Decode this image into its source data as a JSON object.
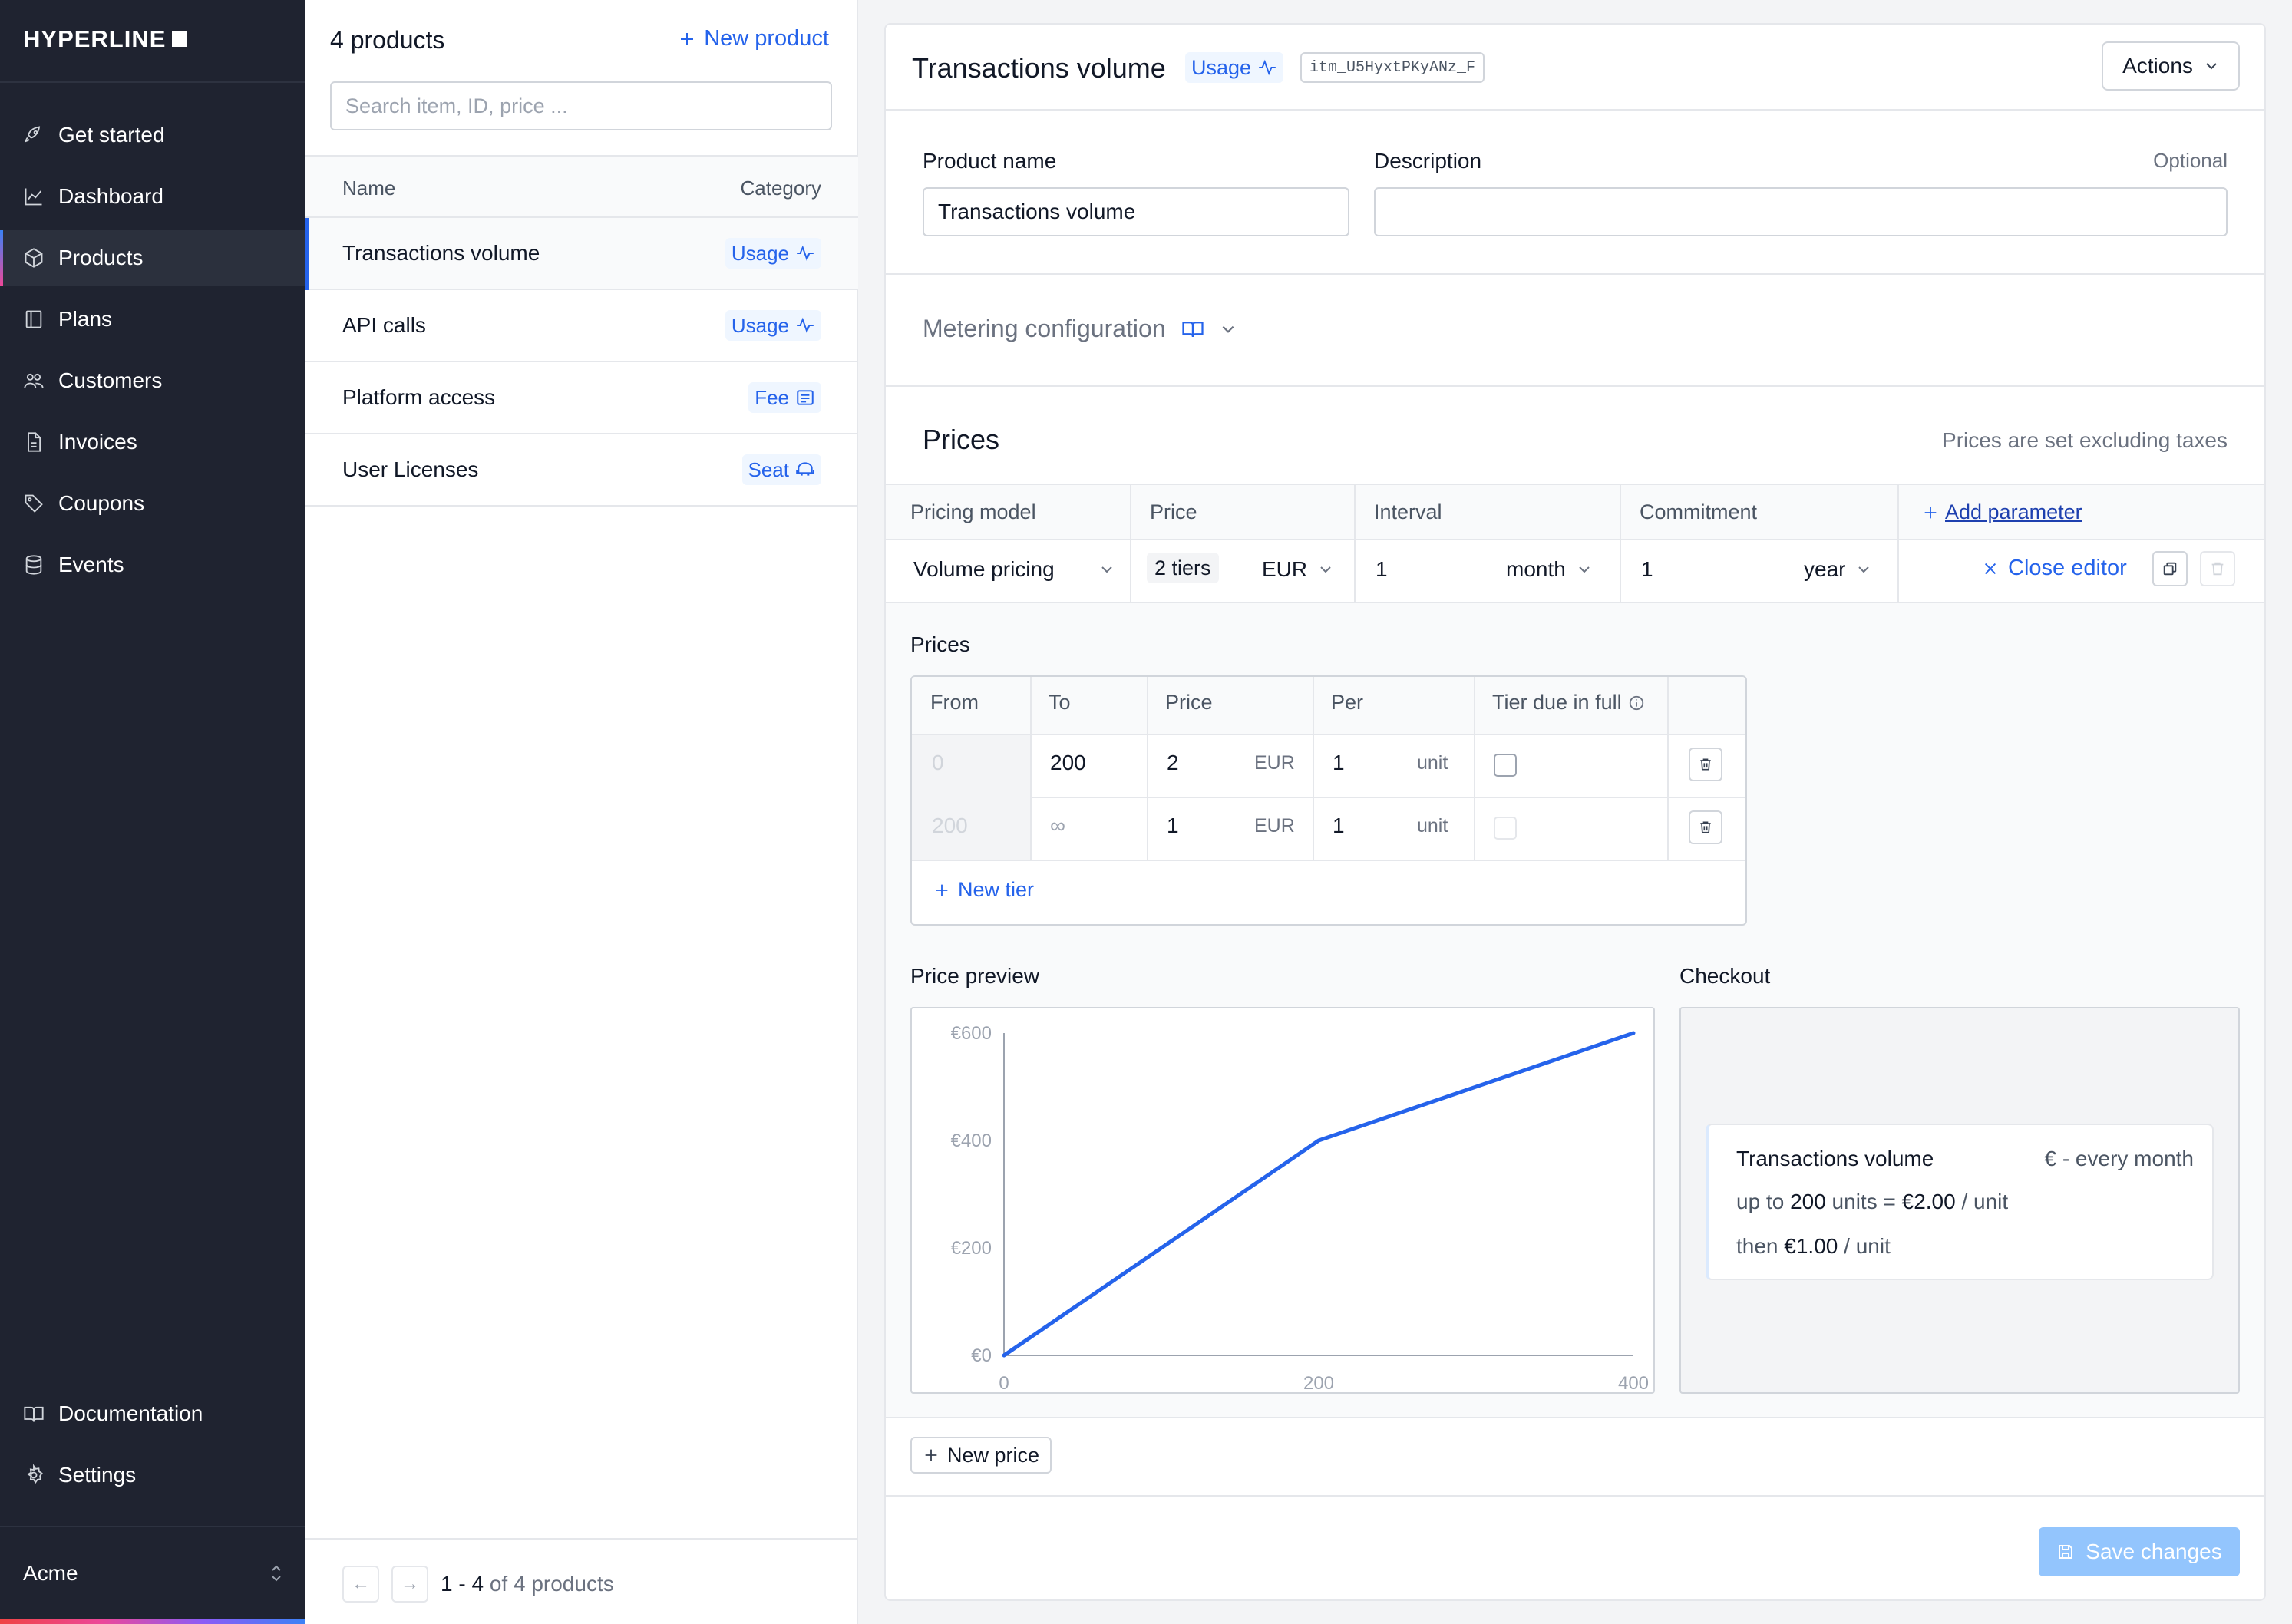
{
  "brand": {
    "logo": "HYPERLINE"
  },
  "nav": {
    "items": [
      {
        "label": "Get started",
        "icon": "rocket-icon"
      },
      {
        "label": "Dashboard",
        "icon": "chart-icon"
      },
      {
        "label": "Products",
        "icon": "box-icon",
        "active": true
      },
      {
        "label": "Plans",
        "icon": "book-icon"
      },
      {
        "label": "Customers",
        "icon": "users-icon"
      },
      {
        "label": "Invoices",
        "icon": "document-icon"
      },
      {
        "label": "Coupons",
        "icon": "tag-icon"
      },
      {
        "label": "Events",
        "icon": "database-icon"
      }
    ],
    "bottom": [
      {
        "label": "Documentation",
        "icon": "book-open-icon"
      },
      {
        "label": "Settings",
        "icon": "gear-icon"
      }
    ],
    "workspace": "Acme"
  },
  "product_list": {
    "title": "4 products",
    "new_product": "New product",
    "search_placeholder": "Search item, ID, price ...",
    "columns": {
      "name": "Name",
      "category": "Category"
    },
    "rows": [
      {
        "name": "Transactions volume",
        "category": "Usage",
        "icon": "activity-icon"
      },
      {
        "name": "API calls",
        "category": "Usage",
        "icon": "activity-icon"
      },
      {
        "name": "Platform access",
        "category": "Fee",
        "icon": "list-icon"
      },
      {
        "name": "User Licenses",
        "category": "Seat",
        "icon": "seat-icon"
      }
    ],
    "pagination": {
      "range_start": "1",
      "sep": " - ",
      "range_end": "4",
      "of": " of ",
      "total": "4",
      "suffix": " products"
    }
  },
  "product": {
    "title": "Transactions volume",
    "category": "Usage",
    "id": "itm_U5HyxtPKyANz_F",
    "actions": "Actions",
    "name_label": "Product name",
    "name_value": "Transactions volume",
    "description_label": "Description",
    "description_optional": "Optional",
    "description_value": "",
    "metering": "Metering configuration"
  },
  "prices": {
    "title": "Prices",
    "note": "Prices are set excluding taxes",
    "config_headers": {
      "model": "Pricing model",
      "price": "Price",
      "interval": "Interval",
      "commitment": "Commitment",
      "add_param": "Add parameter"
    },
    "config": {
      "model": "Volume pricing",
      "tiers": "2 tiers",
      "currency": "EUR",
      "interval_count": "1",
      "interval_unit": "month",
      "commitment_count": "1",
      "commitment_unit": "year",
      "close_editor": "Close editor"
    },
    "editor_title": "Prices",
    "tier_headers": {
      "from": "From",
      "to": "To",
      "price": "Price",
      "per": "Per",
      "due": "Tier due in full"
    },
    "tiers": [
      {
        "from": "0",
        "to": "200",
        "price": "2",
        "currency": "EUR",
        "per": "1",
        "unit": "unit",
        "due_in_full": false
      },
      {
        "from": "200",
        "to": "∞",
        "price": "1",
        "currency": "EUR",
        "per": "1",
        "unit": "unit",
        "due_in_full": false
      }
    ],
    "new_tier": "New tier",
    "preview_label": "Price preview",
    "checkout_label": "Checkout",
    "checkout": {
      "name": "Transactions volume",
      "price": "€ - every month",
      "line1_a": "up to ",
      "line1_b": "200",
      "line1_c": " units = ",
      "line1_d": "€2.00",
      "line1_e": " / unit",
      "line2_a": "then ",
      "line2_b": "€1.00",
      "line2_c": " / unit"
    },
    "new_price": "New price",
    "save": "Save changes"
  },
  "chart_data": {
    "type": "line",
    "x": [
      0,
      200,
      400
    ],
    "y": [
      0,
      400,
      600
    ],
    "xlim": [
      0,
      400
    ],
    "ylim": [
      0,
      600
    ],
    "x_ticks": [
      "0",
      "200",
      "400"
    ],
    "y_ticks": [
      "€0",
      "€200",
      "€400",
      "€600"
    ],
    "y_tick_values": [
      0,
      200,
      400,
      600
    ],
    "x_tick_values": [
      0,
      200,
      400
    ],
    "color": "#2563eb"
  },
  "colors": {
    "accent": "#2563eb",
    "sidebar": "#1f2330"
  }
}
